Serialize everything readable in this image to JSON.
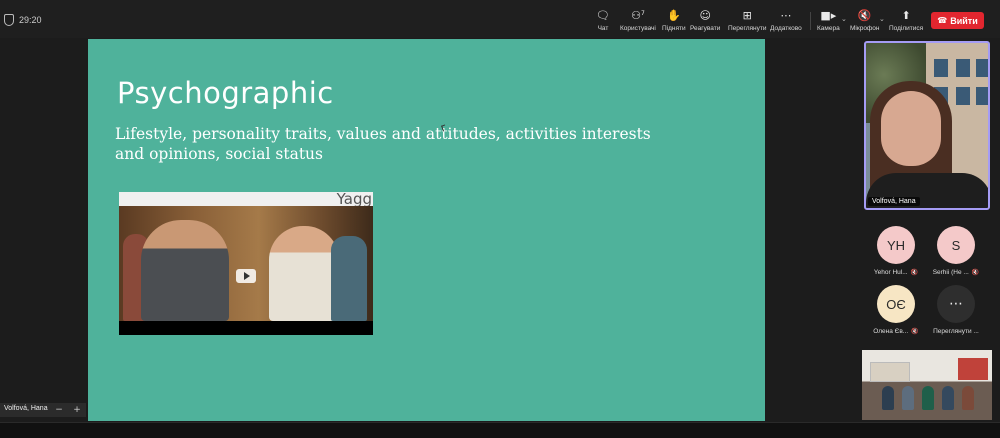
{
  "meeting": {
    "timer": "29:20"
  },
  "toolbar": {
    "chat_label": "Чат",
    "participants_label": "Користувачі",
    "participants_count": "7",
    "raise_label": "Підняти",
    "react_label": "Реагувати",
    "view_label": "Переглянути",
    "more_label": "Додатково",
    "camera_label": "Камера",
    "mic_label": "Мікрофон",
    "share_label": "Поділитися",
    "leave_label": "Вийти",
    "leave_color": "#e2262f"
  },
  "slide": {
    "title": "Psychographic",
    "body": "Lifestyle, personality traits, values and attitudes, activities interests and opinions, social status",
    "video_brand": "Yagg",
    "background": "#4fb29b"
  },
  "speaker": {
    "name": "Volfová, Hana",
    "border_color": "#a59cf5"
  },
  "participants": [
    {
      "initials": "YH",
      "name": "Yehor Hul...",
      "color": "#f4c9c9"
    },
    {
      "initials": "S",
      "name": "Serhii (Не ...",
      "color": "#f4c9c9"
    },
    {
      "initials": "OЄ",
      "name": "Олена Єв...",
      "color": "#f7e6c4"
    }
  ],
  "more_participants": {
    "label": "Переглянути ..."
  },
  "self_view": {
    "name": "Volfová, Hana",
    "zoom_minus": "−",
    "zoom_plus": "+"
  }
}
